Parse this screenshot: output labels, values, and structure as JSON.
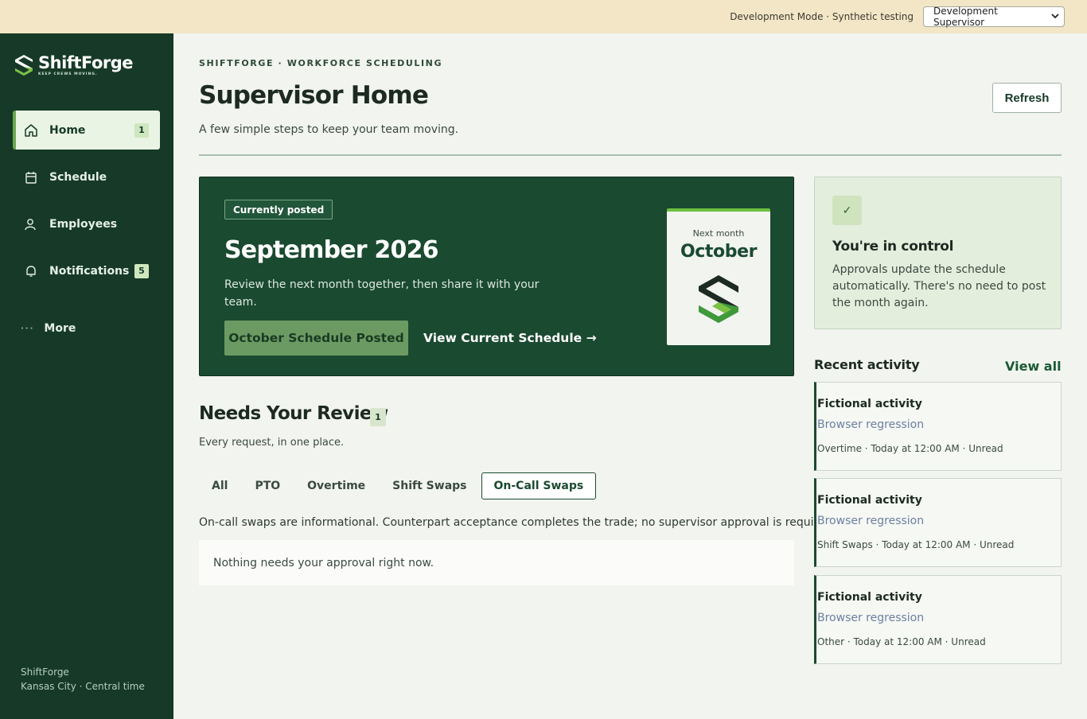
{
  "devbar": {
    "text": "Development Mode · Synthetic testing",
    "role": "Development Supervisor"
  },
  "brand": {
    "name": "ShiftForge",
    "tagline": "KEEP CREWS MOVING."
  },
  "sidebar": {
    "items": [
      {
        "label": "Home",
        "badge": "1"
      },
      {
        "label": "Schedule",
        "badge": ""
      },
      {
        "label": "Employees",
        "badge": ""
      },
      {
        "label": "Notifications",
        "badge": "5"
      }
    ],
    "more": "More",
    "footer_line1": "ShiftForge",
    "footer_line2": "Kansas City · Central time"
  },
  "header": {
    "eyebrow": "SHIFTFORGE · WORKFORCE SCHEDULING",
    "title": "Supervisor Home",
    "subtitle": "A few simple steps to keep your team moving.",
    "refresh": "Refresh"
  },
  "hero": {
    "pill": "Currently posted",
    "title": "September 2026",
    "description": "Review the next month together, then share it with your team.",
    "posted_button": "October Schedule Posted",
    "view_link": "View Current Schedule →",
    "next_label": "Next month",
    "next_month": "October"
  },
  "control": {
    "icon": "✓",
    "title": "You're in control",
    "description": "Approvals update the schedule automatically. There's no need to post the month again."
  },
  "review": {
    "title": "Needs Your Review",
    "badge": "1",
    "subtitle": "Every request, in one place.",
    "tabs": [
      "All",
      "PTO",
      "Overtime",
      "Shift Swaps",
      "On-Call Swaps"
    ],
    "active_tab": "On-Call Swaps",
    "note": "On-call swaps are informational. Counterpart acceptance completes the trade; no supervisor approval is required.",
    "empty": "Nothing needs your approval right now."
  },
  "activity": {
    "heading": "Recent activity",
    "view_all": "View all",
    "items": [
      {
        "title": "Fictional activity",
        "subtitle": "Browser regression",
        "meta": "Overtime · Today at 12:00 AM · Unread"
      },
      {
        "title": "Fictional activity",
        "subtitle": "Browser regression",
        "meta": "Shift Swaps · Today at 12:00 AM · Unread"
      },
      {
        "title": "Fictional activity",
        "subtitle": "Browser regression",
        "meta": "Other · Today at 12:00 AM · Unread"
      }
    ]
  },
  "colors": {
    "sidebar": "#163a27",
    "hero": "#1a4a30",
    "accent": "#6cbf3f",
    "devbar": "#f2e6c6"
  }
}
